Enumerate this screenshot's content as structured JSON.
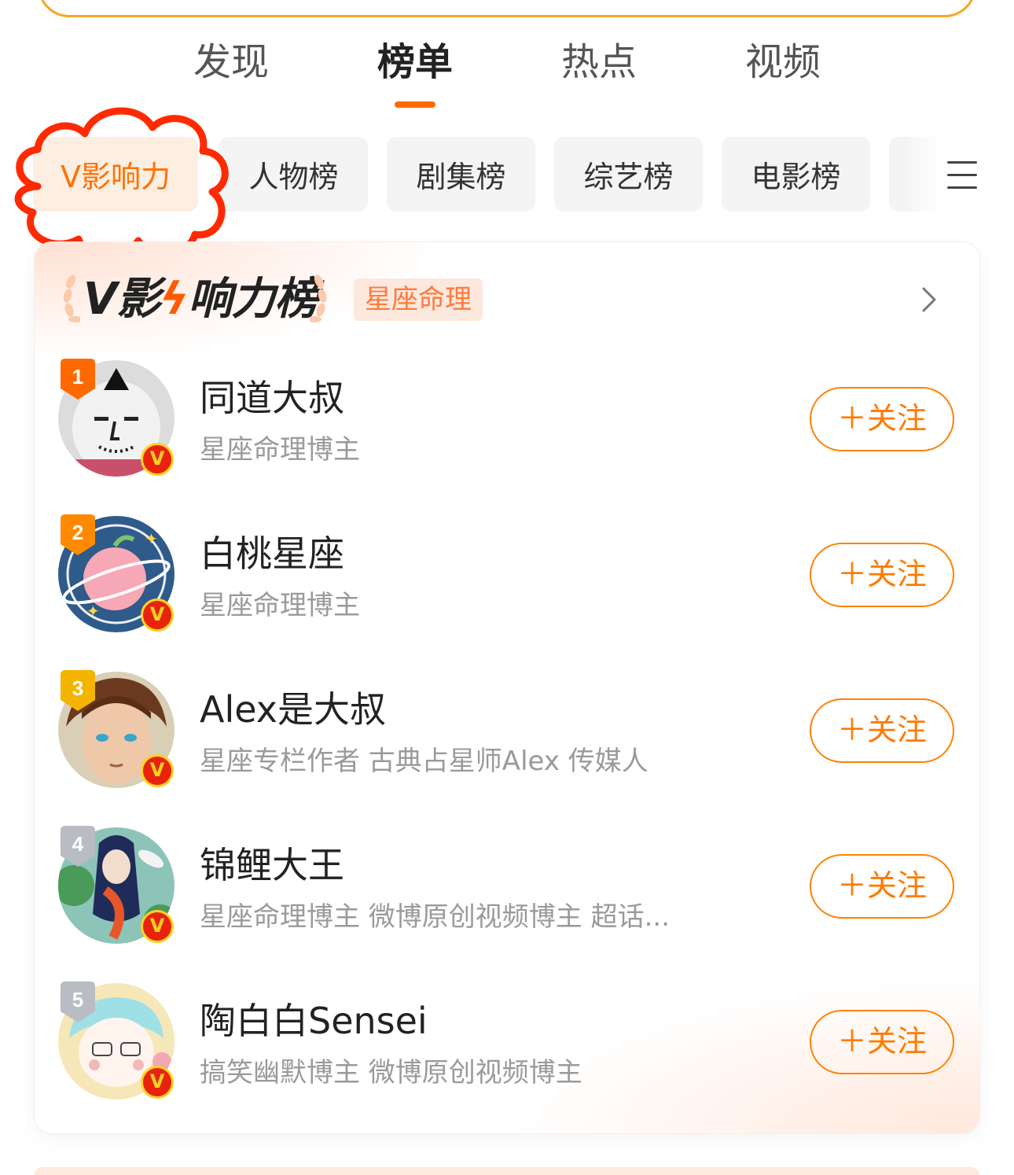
{
  "top_tabs": [
    {
      "label": "发现",
      "active": false
    },
    {
      "label": "榜单",
      "active": true
    },
    {
      "label": "热点",
      "active": false
    },
    {
      "label": "视频",
      "active": false
    }
  ],
  "chips": [
    {
      "label": "V影响力",
      "active": true
    },
    {
      "label": "人物榜",
      "active": false
    },
    {
      "label": "剧集榜",
      "active": false
    },
    {
      "label": "综艺榜",
      "active": false
    },
    {
      "label": "电影榜",
      "active": false
    }
  ],
  "card": {
    "title_v": "V",
    "title_rest_1": "影",
    "title_rest_2": "响力榜",
    "tag": "星座命理"
  },
  "ranking": [
    {
      "rank": "1",
      "name": "同道大叔",
      "desc": "星座命理博主",
      "follow": "＋关注"
    },
    {
      "rank": "2",
      "name": "白桃星座",
      "desc": "星座命理博主",
      "follow": "＋关注"
    },
    {
      "rank": "3",
      "name": "Alex是大叔",
      "desc": "星座专栏作者 古典占星师Alex 传媒人",
      "follow": "＋关注"
    },
    {
      "rank": "4",
      "name": "锦鲤大王",
      "desc": "星座命理博主 微博原创视频博主 超话...",
      "follow": "＋关注"
    },
    {
      "rank": "5",
      "name": "陶白白Sensei",
      "desc": "搞笑幽默博主 微博原创视频博主",
      "follow": "＋关注"
    }
  ],
  "verified_badge": "V",
  "colors": {
    "accent": "#ff7100",
    "gold": "#f5a623",
    "silver": "#b9bcc2"
  }
}
